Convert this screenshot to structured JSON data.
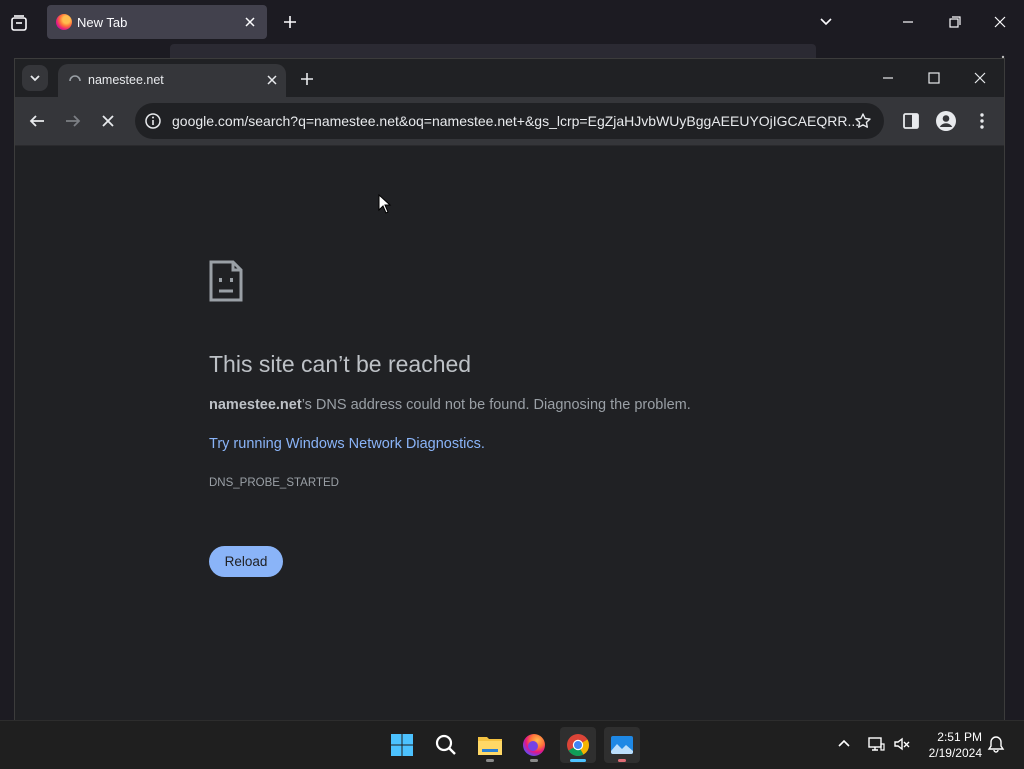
{
  "firefox": {
    "tab_title": "New Tab"
  },
  "chrome": {
    "tab_title": "namestee.net",
    "url": "google.com/search?q=namestee.net&oq=namestee.net+&gs_lcrp=EgZjaHJvbWUyBggAEEUYOjIGCAEQRR...",
    "error": {
      "heading": "This site can’t be reached",
      "host": "namestee.net",
      "description_suffix": "’s DNS address could not be found. Diagnosing the problem.",
      "diagnostics_link": "Try running Windows Network Diagnostics.",
      "error_code": "DNS_PROBE_STARTED",
      "reload_label": "Reload"
    }
  },
  "taskbar": {
    "time": "2:51 PM",
    "date": "2/19/2024"
  },
  "colors": {
    "accent_link": "#8ab4f8",
    "button_bg": "#8ab4f8",
    "page_bg": "#202124"
  }
}
